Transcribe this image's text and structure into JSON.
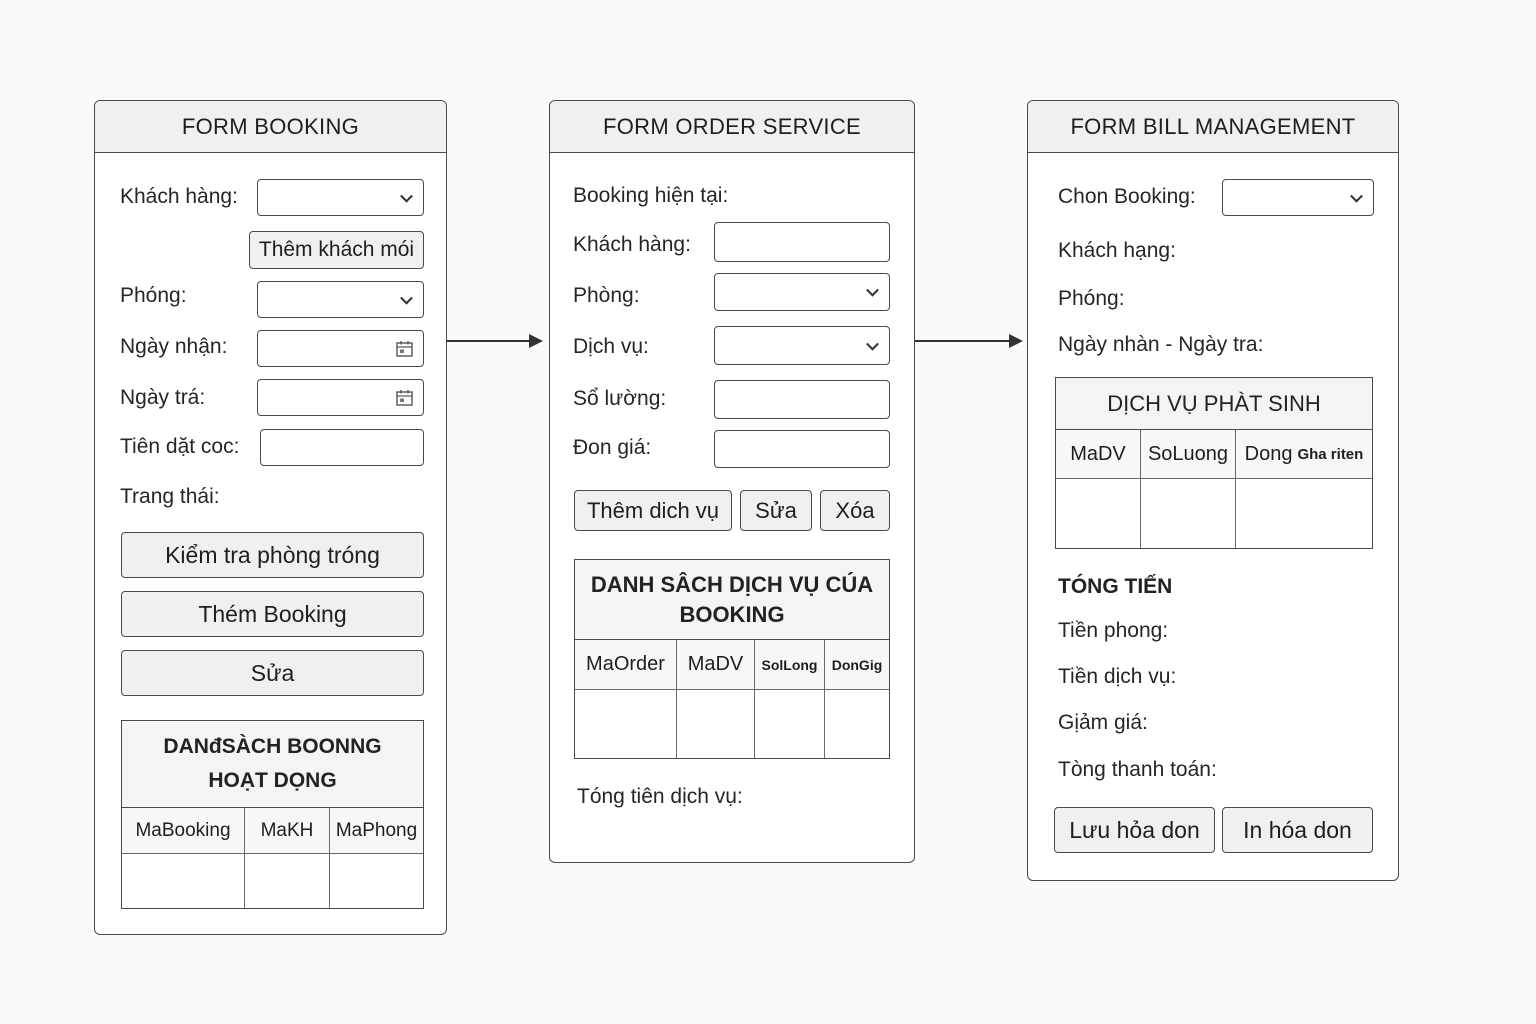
{
  "booking": {
    "title": "FORM BOOKING",
    "customer_label": "Khách hàng:",
    "add_customer_button": "Thêm khách mói",
    "room_label": "Phóng:",
    "checkin_label": "Ngày nhận:",
    "checkout_label": "Ngày trá:",
    "deposit_label": "Tiên dặt coc:",
    "status_label": "Trang thái:",
    "check_room_button": "Kiểm tra phòng tróng",
    "add_booking_button": "Thém Booking",
    "edit_button": "Sửa",
    "table_title_line1": "DANđSÀCH BOONNG",
    "table_title_line2": "HOẠT DỌNG",
    "table_columns": [
      "MaBooking",
      "MaKH",
      "MaPhong"
    ]
  },
  "order": {
    "title": "FORM ORDER SERVICE",
    "current_booking_label": "Booking hiện tại:",
    "customer_label": "Khách hàng:",
    "room_label": "Phòng:",
    "service_label": "Dịch vụ:",
    "quantity_label": "Sổ lường:",
    "price_label": "Đon giá:",
    "add_service_button": "Thêm dich vụ",
    "edit_button": "Sửa",
    "delete_button": "Xóa",
    "table_title_line1": "DANH SÂCH DỊCH VỤ CÚA",
    "table_title_line2": "BOOKING",
    "table_columns": [
      "MaOrder",
      "MaDV",
      "SolLong",
      "DonGig"
    ],
    "total_label": "Tóng tiên dịch vụ:"
  },
  "bill": {
    "title": "FORM BILL MANAGEMENT",
    "select_booking_label": "Chon Booking:",
    "customer_label": "Khách hạng:",
    "room_label": "Phóng:",
    "dates_label": "Ngày nhàn - Ngày tra:",
    "table_title": "DỊCH VỤ PHÀT SINH",
    "table_columns": [
      "MaDV",
      "SoLuong",
      "Dong",
      "Gha riten"
    ],
    "total_title": "TÓNG TIẾN",
    "room_fee_label": "Tiền phong:",
    "service_fee_label": "Tiền dịch vụ:",
    "discount_label": "Gịảm giá:",
    "grand_total_label": "Tòng thanh toán:",
    "save_button": "Lưu hỏa don",
    "print_button": "In hóa don"
  },
  "colors": {
    "border": "#4a4a4a",
    "header_bg": "#f0f0f0",
    "background": "#fafafa"
  }
}
